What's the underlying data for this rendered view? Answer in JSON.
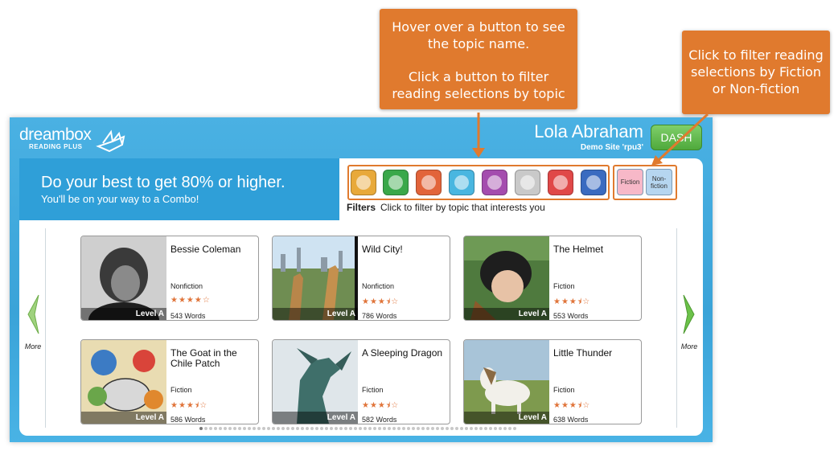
{
  "callouts": {
    "topic": {
      "line1": "Hover over a button to see",
      "line2": "the topic name.",
      "line3": "Click a button to filter",
      "line4": "reading selections by topic"
    },
    "fiction": {
      "line1": "Click to filter reading",
      "line2": "selections by Fiction",
      "line3": "or Non-fiction"
    }
  },
  "header": {
    "brand": "dreambox",
    "brand_sub": "READING PLUS",
    "user_name": "Lola Abraham",
    "site_name": "Demo Site 'rpu3'",
    "dash_label": "DASH"
  },
  "goal": {
    "title": "Do your best to get 80% or higher.",
    "subtitle": "You'll be on your way to a Combo!"
  },
  "filters": {
    "label": "Filters",
    "hint": "Click to filter by topic that interests you",
    "topics": [
      {
        "icon": "people-icon",
        "color": "#e8a93a"
      },
      {
        "icon": "globe-icon",
        "color": "#3aa84a"
      },
      {
        "icon": "flame-icon",
        "color": "#e2643a"
      },
      {
        "icon": "magnifier-icon",
        "color": "#49b6e0"
      },
      {
        "icon": "camera-icon",
        "color": "#a44cae"
      },
      {
        "icon": "tools-icon",
        "color": "#c9c9c9"
      },
      {
        "icon": "gear-icon",
        "color": "#e04848"
      },
      {
        "icon": "ball-icon",
        "color": "#3a6bc0"
      }
    ],
    "fiction_label": "Fiction",
    "nonfiction_label": "Non-fiction"
  },
  "nav": {
    "more_left": "More",
    "more_right": "More"
  },
  "books": [
    {
      "title": "Bessie Coleman",
      "genre": "Nonfiction",
      "stars": "★★★★☆",
      "words": "543 Words",
      "level": "Level A"
    },
    {
      "title": "Wild City!",
      "genre": "Nonfiction",
      "stars": "★★★⯨☆",
      "words": "786 Words",
      "level": "Level A"
    },
    {
      "title": "The Helmet",
      "genre": "Fiction",
      "stars": "★★★⯨☆",
      "words": "553 Words",
      "level": "Level A"
    },
    {
      "title": "The Goat in the Chile Patch",
      "genre": "Fiction",
      "stars": "★★★⯨☆",
      "words": "586 Words",
      "level": "Level A"
    },
    {
      "title": "A Sleeping Dragon",
      "genre": "Fiction",
      "stars": "★★★⯨☆",
      "words": "582 Words",
      "level": "Level A"
    },
    {
      "title": "Little Thunder",
      "genre": "Fiction",
      "stars": "★★★⯨☆",
      "words": "638 Words",
      "level": "Level A"
    }
  ],
  "pager": {
    "current": 1
  }
}
